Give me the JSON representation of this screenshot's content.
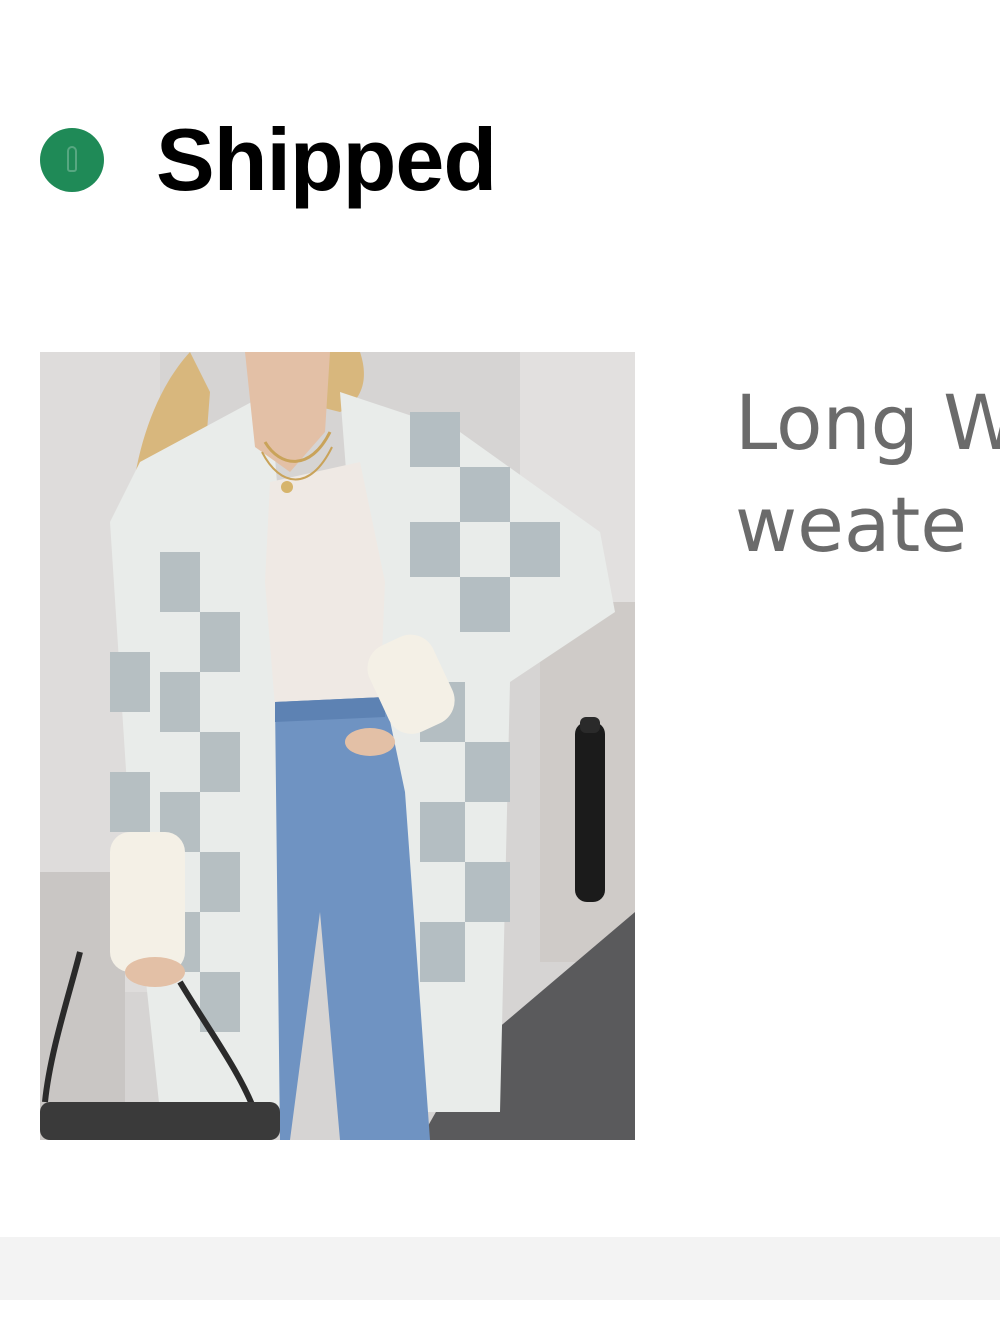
{
  "order": {
    "status": {
      "label": "Shipped",
      "color": "#1f8a57"
    },
    "item": {
      "title": "Long Women's Checkered Cardigan Sweater",
      "visible_title_lines": [
        "Long W",
        "weate"
      ],
      "image_icon": "product-photo-checkered-cardigan"
    }
  }
}
